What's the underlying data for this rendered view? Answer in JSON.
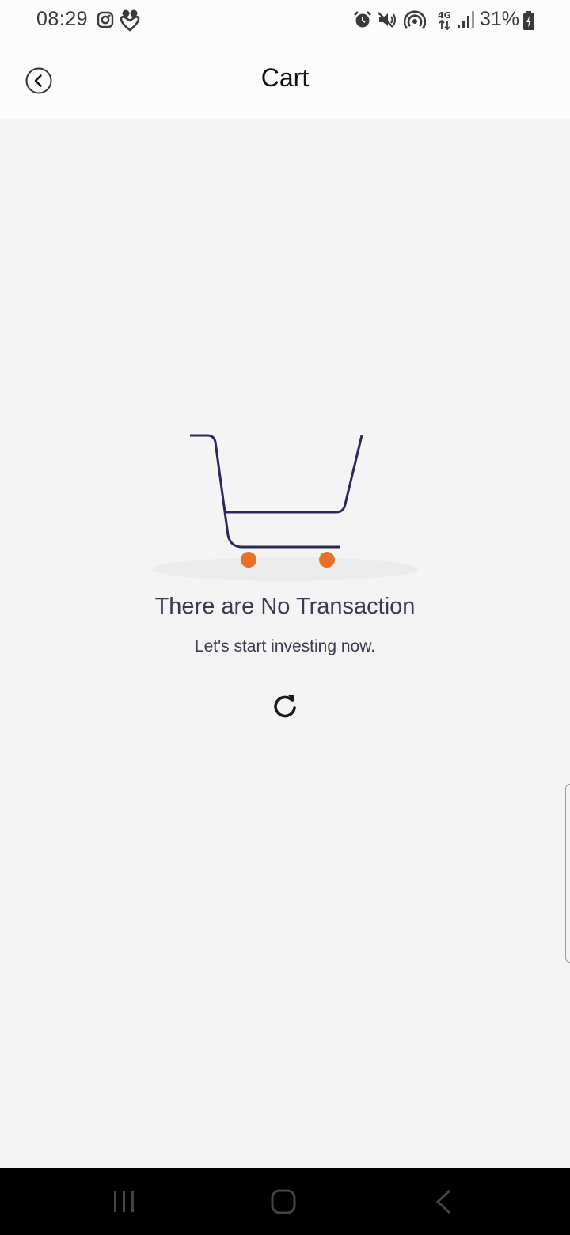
{
  "status_bar": {
    "time": "08:29",
    "battery": "31%",
    "icons": [
      "instagram-icon",
      "app-notification-icon",
      "alarm-icon",
      "mute-icon",
      "hotspot-icon",
      "4g-icon",
      "signal-icon",
      "battery-charging-icon"
    ]
  },
  "header": {
    "title": "Cart",
    "back_icon": "chevron-left-circle-icon"
  },
  "empty_state": {
    "illustration": "shopping-cart-icon",
    "title": "There are No Transaction",
    "subtitle": "Let's start investing now.",
    "refresh_icon": "refresh-icon"
  },
  "nav_bar": {
    "icons": [
      "recent-apps-icon",
      "home-icon",
      "back-icon"
    ]
  },
  "colors": {
    "cart_line": "#2a2a5a",
    "cart_wheels": "#ea6f27",
    "background": "#f4f4f4",
    "header_bg": "#fcfcfc"
  }
}
